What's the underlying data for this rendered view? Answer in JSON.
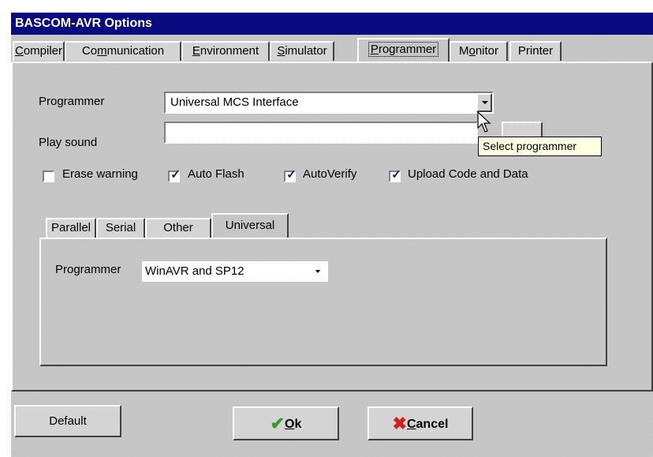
{
  "window": {
    "title": "BASCOM-AVR Options"
  },
  "tabs": [
    {
      "label": "Compiler",
      "mnemonic_index": 0
    },
    {
      "label": "Communication",
      "mnemonic_index": 2
    },
    {
      "label": "Environment",
      "mnemonic_index": 0
    },
    {
      "label": "Simulator",
      "mnemonic_index": 0
    },
    {
      "label": "Programmer",
      "mnemonic_index": 0
    },
    {
      "label": "Monitor",
      "mnemonic_index": 1
    },
    {
      "label": "Printer",
      "mnemonic_index": -1
    }
  ],
  "programmer_section": {
    "programmer_label": "Programmer",
    "programmer_value": "Universal MCS Interface",
    "play_sound_label": "Play sound",
    "play_sound_value": "",
    "tooltip": "Select programmer",
    "checkboxes": [
      {
        "label": "Erase warning",
        "checked": false
      },
      {
        "label": "Auto Flash",
        "checked": true
      },
      {
        "label": "AutoVerify",
        "checked": true
      },
      {
        "label": "Upload Code and Data",
        "checked": true
      }
    ]
  },
  "inner_tabs": [
    "Parallel",
    "Serial",
    "Other",
    "Universal"
  ],
  "universal": {
    "programmer_label": "Programmer",
    "programmer_value": "WinAVR and SP12"
  },
  "buttons": {
    "default_label": "Default",
    "ok_label": "Ok",
    "cancel_label": "Cancel"
  },
  "colors": {
    "titlebar": "#0a0a80",
    "ok_check": "#3a9a2a",
    "cancel_x": "#d02020"
  }
}
